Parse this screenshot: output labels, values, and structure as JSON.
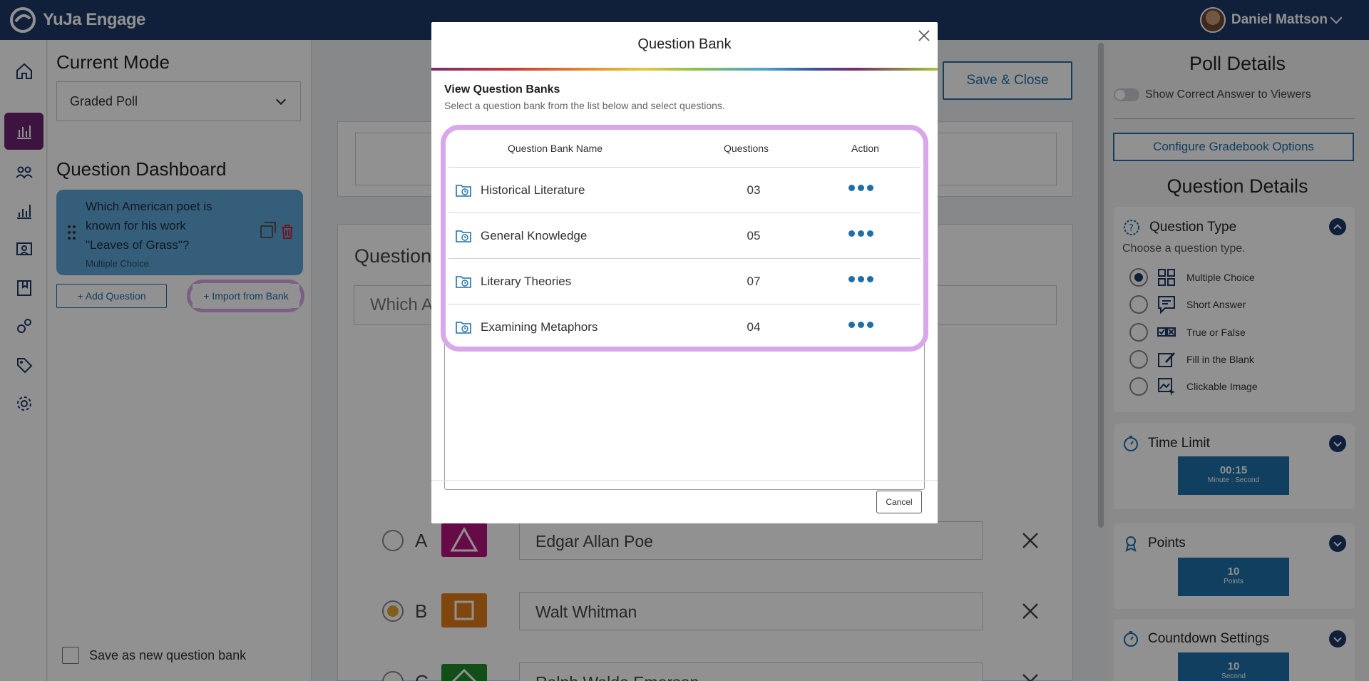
{
  "app": {
    "brand": "YuJa Engage"
  },
  "user": {
    "name": "Daniel Mattson"
  },
  "left_panel": {
    "current_mode_title": "Current Mode",
    "mode_value": "Graded Poll",
    "dashboard_title": "Question Dashboard",
    "question_card": {
      "text": "Which American poet is known for his work \"Leaves of Grass\"?",
      "type": "Multiple Choice"
    },
    "add_question": "+ Add Question",
    "import_from_bank": "+ Import from Bank",
    "save_as_bank": "Save as new question bank"
  },
  "center": {
    "save_close": "Save & Close",
    "question_label": "Question",
    "question_value": "Which A",
    "answers": [
      {
        "letter": "A",
        "text": "Edgar Allan Poe",
        "selected": false,
        "color": "#b5157f"
      },
      {
        "letter": "B",
        "text": "Walt Whitman",
        "selected": true,
        "color": "#e07c1a"
      },
      {
        "letter": "C",
        "text": "Ralph Waldo Emerson",
        "selected": false,
        "color": "#1f8a2b"
      }
    ]
  },
  "right_panel": {
    "poll_details_title": "Poll Details",
    "show_correct_answer": "Show Correct Answer to Viewers",
    "configure_gradebook": "Configure Gradebook Options",
    "question_details_title": "Question Details",
    "question_type": {
      "title": "Question Type",
      "subtitle": "Choose a question type.",
      "options": [
        "Multiple Choice",
        "Short Answer",
        "True or False",
        "Fill in the Blank",
        "Clickable Image"
      ],
      "selected": "Multiple Choice"
    },
    "time_limit": {
      "title": "Time Limit",
      "value": "00:15",
      "unit": "Minute : Second"
    },
    "points": {
      "title": "Points",
      "value": "10",
      "unit": "Points"
    },
    "countdown": {
      "title": "Countdown Settings",
      "value": "10",
      "unit": "Second"
    }
  },
  "modal": {
    "title": "Question Bank",
    "section_title": "View Question Banks",
    "section_subtitle": "Select a question bank from the list below and select questions.",
    "columns": {
      "name": "Question Bank Name",
      "questions": "Questions",
      "action": "Action"
    },
    "banks": [
      {
        "name": "Historical Literature",
        "questions": "03"
      },
      {
        "name": "General Knowledge",
        "questions": "05"
      },
      {
        "name": "Literary Theories",
        "questions": "07"
      },
      {
        "name": "Examining Metaphors",
        "questions": "04"
      }
    ],
    "cancel": "Cancel"
  },
  "colors": {
    "topbar": "#1d3766",
    "accent": "#1e6fa8",
    "highlight_ring": "#d8a8ea",
    "active_rail": "#6b2470"
  },
  "icons": [
    "home-icon",
    "poll-icon",
    "users-icon",
    "analytics-icon",
    "classroom-icon",
    "bookmark-icon",
    "integrations-icon",
    "tag-icon",
    "settings-icon",
    "folder-clock-icon",
    "more-dots-icon",
    "close-icon"
  ]
}
